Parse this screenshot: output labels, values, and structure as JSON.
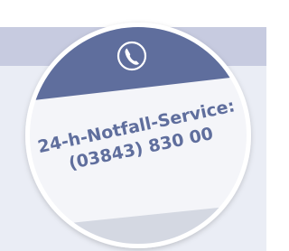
{
  "badge": {
    "line1": "24-h-Notfall-Service:",
    "line2": "(03843) 830 00"
  },
  "icons": {
    "phone": "phone-icon"
  },
  "colors": {
    "navy": "#5f6e9d",
    "circle_fill": "#f4f5f9",
    "circle_rim": "#ffffff",
    "bottom_band": "#d4d8e2",
    "text": "#5f6e9d",
    "band_upper": "#c7cbe0",
    "band_lower": "#eaedf5"
  }
}
